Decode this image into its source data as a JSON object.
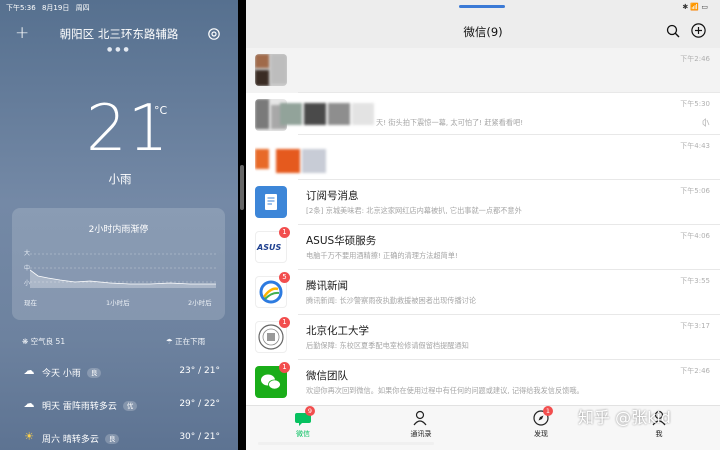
{
  "weather": {
    "status_bar": {
      "time": "下午5:36",
      "date": "8月19日",
      "weekday": "周四"
    },
    "location": "朝阳区 北三环东路辅路",
    "temperature": "21",
    "unit": "°C",
    "condition": "小雨",
    "precip_card": {
      "title": "2小时内雨渐停",
      "y_labels": [
        "大",
        "中",
        "小"
      ],
      "x_labels": [
        "现在",
        "1小时后",
        "2小时后"
      ]
    },
    "aqi": "空气良 51",
    "rain_now": "正在下雨",
    "forecast": [
      {
        "icon": "rain-cloud-icon",
        "day": "今天 小雨",
        "aqi": "良",
        "temps": "23° / 21°"
      },
      {
        "icon": "thunder-cloud-icon",
        "day": "明天 雷阵雨转多云",
        "aqi": "优",
        "temps": "29° / 22°"
      },
      {
        "icon": "sun-cloud-icon",
        "day": "周六 晴转多云",
        "aqi": "良",
        "temps": "30° / 21°"
      }
    ]
  },
  "wechat": {
    "title": "微信(9)",
    "chats": [
      {
        "name": "",
        "preview": "",
        "time": "下午2:46",
        "badge": ""
      },
      {
        "name": "",
        "preview": "天! 街头拍下震惊一幕, 太可怕了! 赶紧看看吧!",
        "time": "下午5:30",
        "badge": ""
      },
      {
        "name": "",
        "preview": "",
        "time": "下午4:43",
        "badge": ""
      },
      {
        "name": "订阅号消息",
        "preview": "[2条] 京城美味君: 北京这家网红店内幕被扒, 它出事就一点都不意外",
        "time": "下午5:06",
        "badge": ""
      },
      {
        "name": "ASUS华硕服务",
        "preview": "电脑千万不要用酒精擦! 正确的清理方法超简单!",
        "time": "下午4:06",
        "badge": "1"
      },
      {
        "name": "腾讯新闻",
        "preview": "腾讯新闻: 长沙警察雨夜执勤救援被困者出现传播讨论",
        "time": "下午3:55",
        "badge": "5"
      },
      {
        "name": "北京化工大学",
        "preview": "后勤保障: 东校区夏季配电室检修请假留档提醒通知",
        "time": "下午3:17",
        "badge": "1"
      },
      {
        "name": "微信团队",
        "preview": "欢迎你再次回到微信。如果你在使用过程中有任何的问题或建议, 记得给我发信反馈哦。",
        "time": "下午2:46",
        "badge": "1"
      }
    ],
    "tabs": [
      {
        "label": "微信",
        "badge": "9"
      },
      {
        "label": "通讯录",
        "badge": ""
      },
      {
        "label": "发现",
        "badge": "1"
      },
      {
        "label": "我",
        "badge": ""
      }
    ],
    "accent": "#07c160"
  },
  "watermark": "知乎 @张kid"
}
